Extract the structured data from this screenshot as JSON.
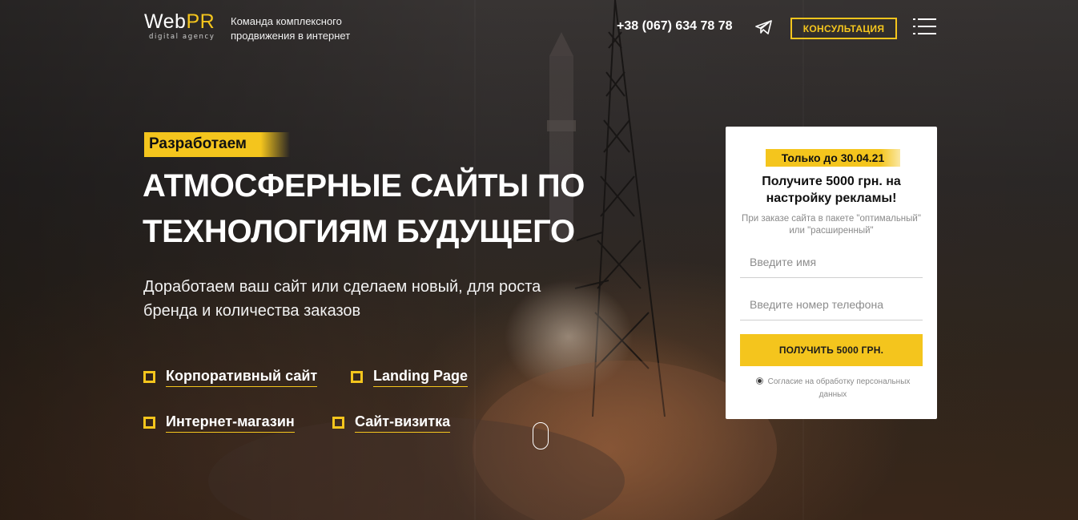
{
  "header": {
    "logo": {
      "main": "Web",
      "accent": "PR",
      "sub": "digital agency"
    },
    "tagline": "Команда комплексного продвижения в интернет",
    "phone": "+38 (067) 634 78 78",
    "consult_label": "КОНСУЛЬТАЦИЯ",
    "telegram_icon": "telegram-icon",
    "menu_icon": "menu-icon"
  },
  "hero": {
    "badge": "Разработаем",
    "title": "АТМОСФЕРНЫЕ САЙТЫ ПО ТЕХНОЛОГИЯМ БУДУЩЕГО",
    "subtitle": "Доработаем ваш сайт или сделаем новый, для роста бренда и количества заказов",
    "services": [
      {
        "label": "Корпоративный сайт"
      },
      {
        "label": "Landing Page"
      },
      {
        "label": "Интернет-магазин"
      },
      {
        "label": "Сайт-визитка"
      }
    ]
  },
  "form": {
    "promo": "Только до 30.04.21",
    "title": "Получите 5000 грн. на настройку рекламы!",
    "note": "При заказе сайта в пакете \"оптимальный\" или \"расширенный\"",
    "name_placeholder": "Введите имя",
    "phone_placeholder": "Введите номер телефона",
    "submit_label": "ПОЛУЧИТЬ 5000 ГРН.",
    "consent": "Согласие на обработку персональных данных"
  },
  "colors": {
    "accent": "#f4c51d",
    "card_bg": "#ffffff",
    "text_light": "#ffffff"
  }
}
